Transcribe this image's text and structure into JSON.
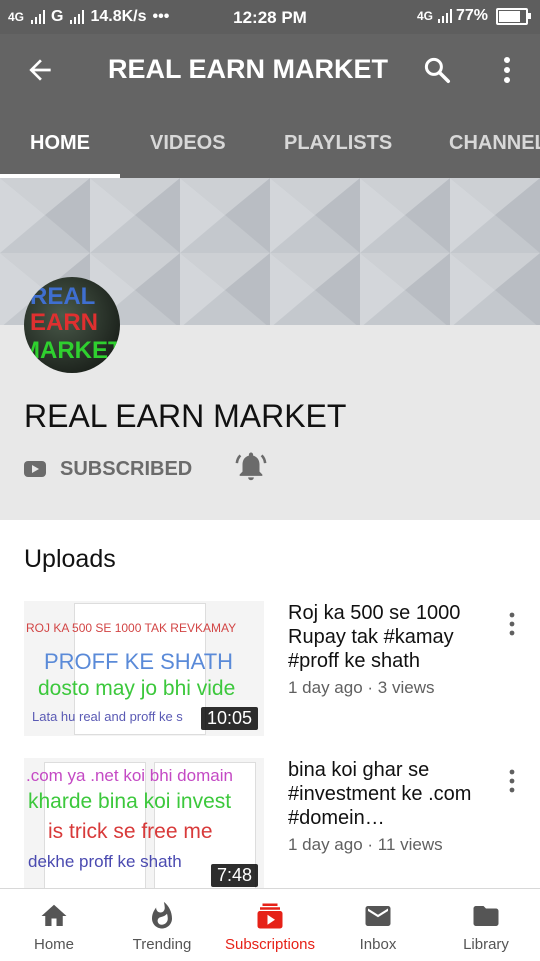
{
  "status_bar": {
    "network1": "4G",
    "network2": "G",
    "speed": "14.8K/s",
    "dots": "•••",
    "time": "12:28 PM",
    "network3": "4G",
    "battery": "77%"
  },
  "app_bar": {
    "title": "REAL EARN MARKET"
  },
  "tabs": [
    {
      "label": "HOME",
      "active": true
    },
    {
      "label": "VIDEOS"
    },
    {
      "label": "PLAYLISTS"
    },
    {
      "label": "CHANNELS"
    }
  ],
  "channel": {
    "name": "REAL EARN MARKET",
    "subscribe_label": "SUBSCRIBED",
    "avatar_text": [
      "REAL",
      "EARN",
      "MARKET"
    ]
  },
  "section": {
    "title": "Uploads"
  },
  "videos": [
    {
      "title": "Roj ka 500 se 1000 Rupay tak #kamay #proff ke shath",
      "meta": "1 day ago · 3 views",
      "duration": "10:05",
      "thumb_captions": [
        "ROJ KA 500 SE 1000 TAK REVKAMAY",
        "PROFF KE SHATH",
        "dosto may jo bhi vide",
        "Lata hu real and proff ke s"
      ]
    },
    {
      "title": "bina koi ghar se #investment ke .com #domein…",
      "meta": "1 day ago · 11 views",
      "duration": "7:48",
      "thumb_captions": [
        ".com ya .net koi bhi domain",
        "kharde bina koi invest",
        "is trick se free me",
        "dekhe proff ke shath"
      ]
    }
  ],
  "bottom_nav": [
    {
      "label": "Home",
      "icon": "home-icon"
    },
    {
      "label": "Trending",
      "icon": "trending-flame-icon"
    },
    {
      "label": "Subscriptions",
      "icon": "subscriptions-icon",
      "active": true
    },
    {
      "label": "Inbox",
      "icon": "inbox-mail-icon"
    },
    {
      "label": "Library",
      "icon": "library-folder-icon"
    }
  ],
  "colors": {
    "app_bar": "#646464",
    "status_bar": "#5e5e5e",
    "accent_red": "#e62117",
    "channel_header_bg": "#e8e8e8"
  }
}
